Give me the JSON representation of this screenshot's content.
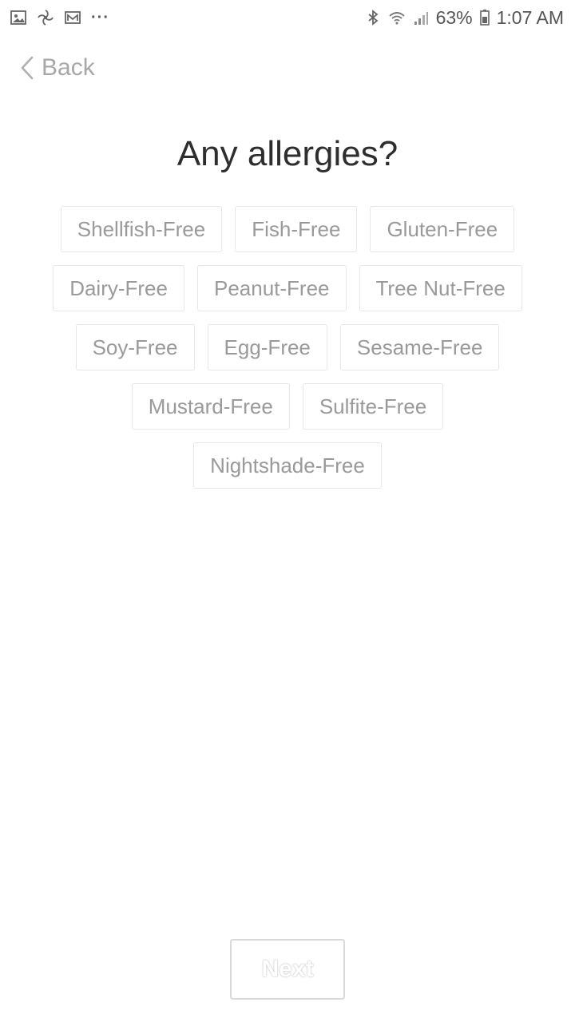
{
  "status_bar": {
    "left_icons": [
      "gallery-icon",
      "pinwheel-icon",
      "mail-icon"
    ],
    "more": "···",
    "right_icons": [
      "bluetooth-icon",
      "wifi-icon",
      "signal-icon"
    ],
    "battery": "63%",
    "time": "1:07 AM"
  },
  "nav": {
    "back_label": "Back"
  },
  "page": {
    "title": "Any allergies?"
  },
  "allergies": {
    "rows": [
      [
        "Shellfish-Free",
        "Fish-Free",
        "Gluten-Free"
      ],
      [
        "Dairy-Free",
        "Peanut-Free",
        "Tree Nut-Free"
      ],
      [
        "Soy-Free",
        "Egg-Free",
        "Sesame-Free"
      ],
      [
        "Mustard-Free",
        "Sulfite-Free"
      ],
      [
        "Nightshade-Free"
      ]
    ]
  },
  "footer": {
    "next_label": "Next"
  },
  "colors": {
    "chip_border": "#e6e6e6",
    "chip_text": "#9a9a9a",
    "title_text": "#2e2e2e",
    "back_text": "#a8a8a8"
  }
}
